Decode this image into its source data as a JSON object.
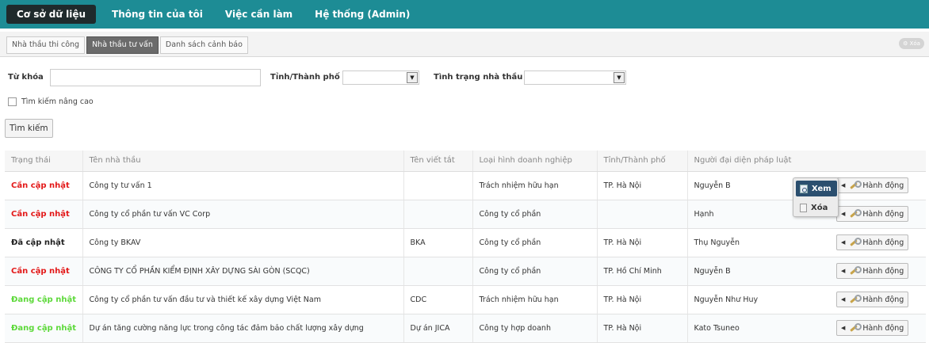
{
  "top_nav": {
    "items": [
      {
        "label": "Cơ sở dữ liệu"
      },
      {
        "label": "Thông tin của tôi"
      },
      {
        "label": "Việc cần làm"
      },
      {
        "label": "Hệ thống (Admin)"
      }
    ]
  },
  "sub_tabs": [
    {
      "label": "Nhà thầu thi công"
    },
    {
      "label": "Nhà thầu tư vấn"
    },
    {
      "label": "Danh sách cảnh báo"
    }
  ],
  "tab_right_label": "⚙ Xóa",
  "filters": {
    "keyword_label": "Từ khóa",
    "keyword_value": "",
    "province_label": "Tỉnh/Thành phố",
    "province_value": "",
    "status_label": "Tình trạng nhà thầu",
    "status_value": "",
    "advanced_label": "Tìm kiếm nâng cao",
    "search_button": "Tìm kiếm"
  },
  "table": {
    "headers": [
      "Trạng thái",
      "Tên nhà thầu",
      "Tên viết tắt",
      "Loại hình doanh nghiệp",
      "Tỉnh/Thành phố",
      "Người đại diện pháp luật"
    ],
    "rows": [
      {
        "status": "Cần cập nhật",
        "status_color": "#e31919",
        "name": "Công ty tư vấn 1",
        "abbr": "",
        "type": "Trách nhiệm hữu hạn",
        "province": "TP. Hà Nội",
        "rep": "Nguyễn B",
        "action": "Hành động"
      },
      {
        "status": "Cần cập nhật",
        "status_color": "#e31919",
        "name": "Công ty cổ phần tư vấn VC Corp",
        "abbr": "",
        "type": "Công ty cổ phần",
        "province": "",
        "rep": "Hạnh",
        "action": "Hành động"
      },
      {
        "status": "Đã cập nhật",
        "status_color": "#222222",
        "name": "Công ty BKAV",
        "abbr": "BKA",
        "type": "Công ty cổ phần",
        "province": "TP. Hà Nội",
        "rep": "Thụ Nguyễn",
        "action": "Hành động"
      },
      {
        "status": "Cần cập nhật",
        "status_color": "#e31919",
        "name": "CÔNG TY CỔ PHẦN KIỂM ĐỊNH XÂY DỰNG SÀI GÒN (SCQC)",
        "abbr": "",
        "type": "Công ty cổ phần",
        "province": "TP. Hồ Chí Minh",
        "rep": "Nguyễn B",
        "action": "Hành động"
      },
      {
        "status": "Đang cập nhật",
        "status_color": "#5dd93a",
        "name": "Công ty cổ phần tư vấn đầu tư và thiết kế xây dựng Việt Nam",
        "abbr": "CDC",
        "type": "Trách nhiệm hữu hạn",
        "province": "TP. Hà Nội",
        "rep": "Nguyễn Như Huy",
        "action": "Hành động"
      },
      {
        "status": "Đang cập nhật",
        "status_color": "#5dd93a",
        "name": "Dự án tăng cường năng lực trong công tác đảm bảo chất lượng xây dựng",
        "abbr": "Dự án JICA",
        "type": "Công ty hợp doanh",
        "province": "TP. Hà Nội",
        "rep": "Kato Tsuneo",
        "action": "Hành động"
      }
    ]
  },
  "popup_menu": {
    "items": [
      {
        "label": "Xem"
      },
      {
        "label": "Xóa"
      }
    ]
  },
  "colors": {
    "topbar": "#1d8c95",
    "active_nav": "#1f2a2c",
    "popup_selected": "#2b4f6f"
  }
}
